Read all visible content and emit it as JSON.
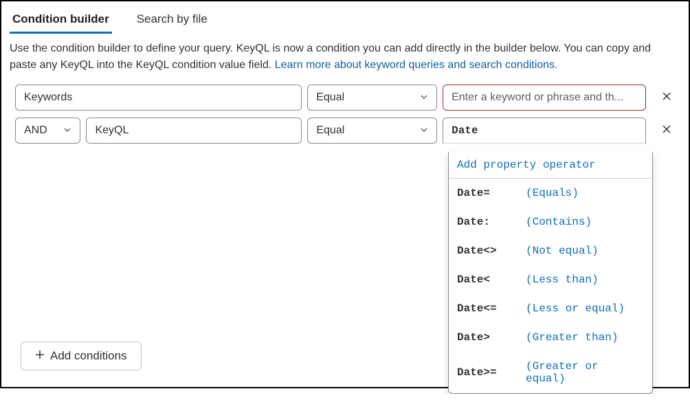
{
  "tabs": {
    "condition_builder": "Condition builder",
    "search_by_file": "Search by file"
  },
  "description": {
    "text": "Use the condition builder to define your query. KeyQL is now a condition you can add directly in the builder below. You can copy and paste any KeyQL into the KeyQL condition value field. ",
    "link": "Learn more about keyword queries and search conditions."
  },
  "row1": {
    "field": "Keywords",
    "operator": "Equal",
    "value_placeholder": "Enter a keyword or phrase and th..."
  },
  "row2": {
    "logic": "AND",
    "property": "KeyQL",
    "operator": "Equal",
    "keyql_value": "Date"
  },
  "dropdown": {
    "header": "Add property operator",
    "items": [
      {
        "code": "Date=",
        "desc": "(Equals)"
      },
      {
        "code": "Date:",
        "desc": "(Contains)"
      },
      {
        "code": "Date<>",
        "desc": "(Not equal)"
      },
      {
        "code": "Date<",
        "desc": "(Less than)"
      },
      {
        "code": "Date<=",
        "desc": "(Less or equal)"
      },
      {
        "code": "Date>",
        "desc": "(Greater than)"
      },
      {
        "code": "Date>=",
        "desc": "(Greater or equal)"
      }
    ]
  },
  "add_conditions_label": "Add conditions"
}
